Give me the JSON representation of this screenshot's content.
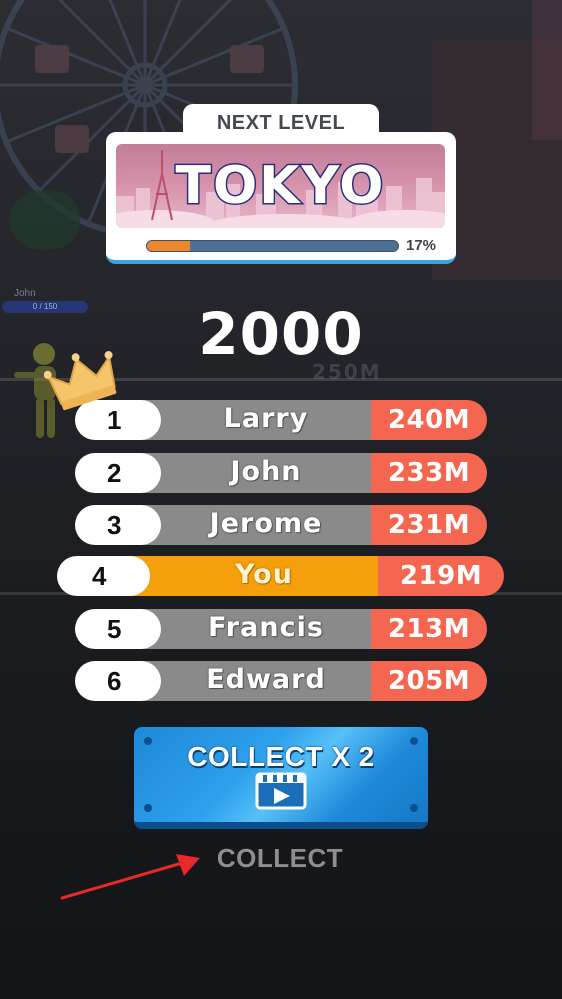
{
  "next_level": {
    "header": "NEXT LEVEL",
    "city": "TOKYO",
    "progress_percent": 17,
    "progress_label": "17%"
  },
  "score": "2000",
  "background": {
    "player_name": "John",
    "player_bar": "0 / 150",
    "distance_marker": "250M"
  },
  "leaderboard": [
    {
      "rank": "1",
      "name": "Larry",
      "distance": "240M",
      "is_you": false
    },
    {
      "rank": "2",
      "name": "John",
      "distance": "233M",
      "is_you": false
    },
    {
      "rank": "3",
      "name": "Jerome",
      "distance": "231M",
      "is_you": false
    },
    {
      "rank": "4",
      "name": "You",
      "distance": "219M",
      "is_you": true
    },
    {
      "rank": "5",
      "name": "Francis",
      "distance": "213M",
      "is_you": false
    },
    {
      "rank": "6",
      "name": "Edward",
      "distance": "205M",
      "is_you": false
    }
  ],
  "buttons": {
    "collect_double": "COLLECT X 2",
    "collect": "COLLECT"
  },
  "colors": {
    "row_grey": "#8a8a8a",
    "row_you": "#f59f0b",
    "distance_red": "#f4664f",
    "progress_orange": "#f0862b",
    "button_blue": "#2ea0ec"
  },
  "icons": [
    "crown-icon",
    "video-play-icon",
    "red-arrow-annotation"
  ]
}
